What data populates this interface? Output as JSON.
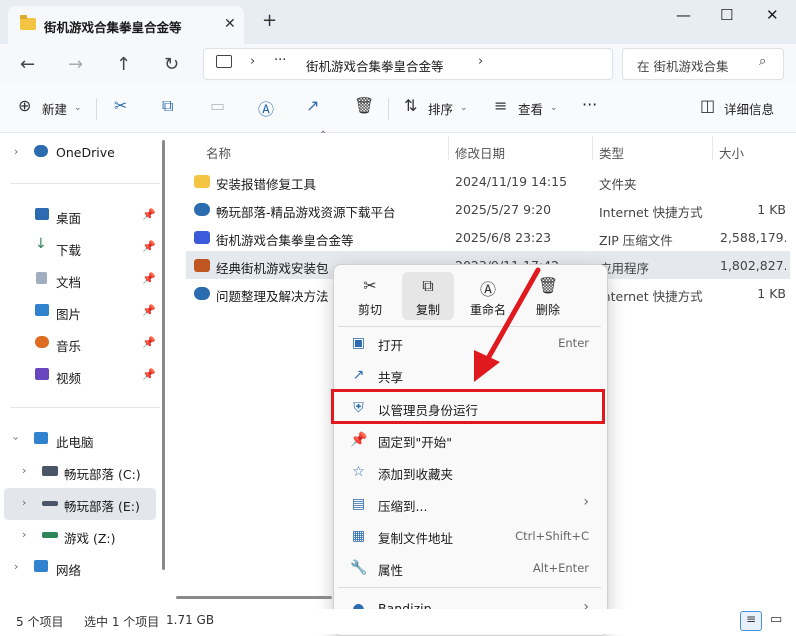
{
  "window": {
    "tab_title": "街机游戏合集拳皇合金等",
    "tab_close": "✕",
    "new_tab": "+",
    "minimize": "—",
    "maximize": "☐",
    "close": "✕"
  },
  "nav": {
    "back": "←",
    "forward": "→",
    "up": "↑",
    "refresh": "↻",
    "more": "···",
    "breadcrumb": "街机游戏合集拳皇合金等",
    "search_placeholder": "在 街机游戏合集"
  },
  "toolbar": {
    "new_label": "新建",
    "sort_label": "排序",
    "view_label": "查看",
    "more": "···",
    "details_label": "详细信息"
  },
  "sidebar": {
    "onedrive": "OneDrive",
    "quick": [
      {
        "label": "桌面",
        "color": "#2b6cb0"
      },
      {
        "label": "下载",
        "color": "#2f855a"
      },
      {
        "label": "文档",
        "color": "#718096"
      },
      {
        "label": "图片",
        "color": "#3182ce"
      },
      {
        "label": "音乐",
        "color": "#dd6b20"
      },
      {
        "label": "视频",
        "color": "#6b46c1"
      }
    ],
    "this_pc": "此电脑",
    "drives": [
      "畅玩部落 (C:)",
      "畅玩部落 (E:)",
      "游戏 (Z:)"
    ],
    "network": "网络"
  },
  "columns": {
    "name": "名称",
    "date": "修改日期",
    "type": "类型",
    "size": "大小"
  },
  "files": [
    {
      "name": "安装报错修复工具",
      "date": "2024/11/19 14:15",
      "type": "文件夹",
      "size": "",
      "color": "#f4c542"
    },
    {
      "name": "畅玩部落-精品游戏资源下载平台",
      "date": "2025/5/27 9:20",
      "type": "Internet 快捷方式",
      "size": "1 KB",
      "color": "#2b6cb0"
    },
    {
      "name": "街机游戏合集拳皇合金等",
      "date": "2025/6/8 23:23",
      "type": "ZIP 压缩文件",
      "size": "2,588,179...",
      "color": "#3b5bdb"
    },
    {
      "name": "经典街机游戏安装包",
      "date": "2023/9/11 17:42",
      "type": "应用程序",
      "size": "1,802,827...",
      "color": "#c05621"
    },
    {
      "name": "问题整理及解决方法",
      "date": "",
      "type": "Internet 快捷方式",
      "size": "1 KB",
      "color": "#2b6cb0"
    }
  ],
  "context_menu": {
    "quick_actions": [
      {
        "label": "剪切",
        "icon": "✂"
      },
      {
        "label": "复制",
        "icon": "⧉"
      },
      {
        "label": "重命名",
        "icon": "Ⓐ"
      },
      {
        "label": "删除",
        "icon": "🗑"
      }
    ],
    "items": [
      {
        "label": "打开",
        "shortcut": "Enter",
        "icon": "▣"
      },
      {
        "label": "共享",
        "shortcut": "",
        "icon": "↗"
      },
      {
        "label": "以管理员身份运行",
        "shortcut": "",
        "icon": "⛨"
      },
      {
        "label": "固定到\"开始\"",
        "shortcut": "",
        "icon": "📌"
      },
      {
        "label": "添加到收藏夹",
        "shortcut": "",
        "icon": "☆"
      },
      {
        "label": "压缩到...",
        "shortcut": "›",
        "icon": "▤"
      },
      {
        "label": "复制文件地址",
        "shortcut": "Ctrl+Shift+C",
        "icon": "▦"
      },
      {
        "label": "属性",
        "shortcut": "Alt+Enter",
        "icon": "🔧"
      },
      {
        "label": "Bandizip",
        "shortcut": "›",
        "icon": "●"
      }
    ],
    "highlight_color": "#e0191e"
  },
  "status": {
    "count": "5 个项目",
    "selected": "选中 1 个项目",
    "size": "1.71 GB"
  }
}
